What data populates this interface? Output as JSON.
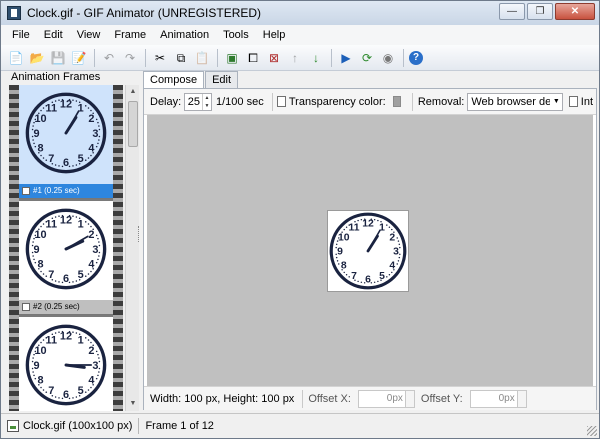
{
  "window": {
    "title": "Clock.gif - GIF Animator (UNREGISTERED)",
    "minimize": "—",
    "maximize": "❐",
    "close": "✕"
  },
  "menu": [
    "File",
    "Edit",
    "View",
    "Frame",
    "Animation",
    "Tools",
    "Help"
  ],
  "toolbar": {
    "new_icon": "📄",
    "open_icon": "📂",
    "save_icon": "💾",
    "properties_icon": "📝",
    "undo_icon": "↶",
    "redo_icon": "↷",
    "cut_icon": "✂",
    "copy_icon": "⧉",
    "paste_icon": "📋",
    "add_frame_icon": "▣",
    "duplicate_frame_icon": "⧠",
    "delete_frame_icon": "⊠",
    "move_up_icon": "↑",
    "move_down_icon": "↓",
    "play_icon": "▶",
    "loop_icon": "⟳",
    "settings_icon": "◉",
    "help_icon": "?"
  },
  "left_panel": {
    "header": "Animation Frames",
    "frames": [
      {
        "caption": "#1 (0.25 sec)",
        "selected": true,
        "hour": 1,
        "minute": 5
      },
      {
        "caption": "#2 (0.25 sec)",
        "selected": false,
        "hour": 2,
        "minute": 10
      },
      {
        "caption": "",
        "selected": false,
        "hour": 3,
        "minute": 15
      }
    ]
  },
  "tabs": [
    {
      "label": "Compose",
      "active": true
    },
    {
      "label": "Edit",
      "active": false
    }
  ],
  "compose": {
    "delay_label": "Delay:",
    "delay_value": "25",
    "delay_unit": "1/100 sec",
    "transparency_label": "Transparency color:",
    "transparency_color": "#a0a0a0",
    "removal_label": "Removal:",
    "removal_value": "Web browser de",
    "interlace_label": "Int",
    "preview": {
      "hour": 1,
      "minute": 5
    },
    "size_text": "Width: 100 px, Height: 100 px",
    "offset_x_label": "Offset X:",
    "offset_x_value": "0px",
    "offset_y_label": "Offset Y:",
    "offset_y_value": "0px"
  },
  "status": {
    "file": "Clock.gif (100x100 px)",
    "frame": "Frame 1 of 12"
  },
  "colors": {
    "clock_ink": "#1a2340",
    "selected_frame": "#2e86de",
    "canvas_bg": "#c0c0c0"
  }
}
